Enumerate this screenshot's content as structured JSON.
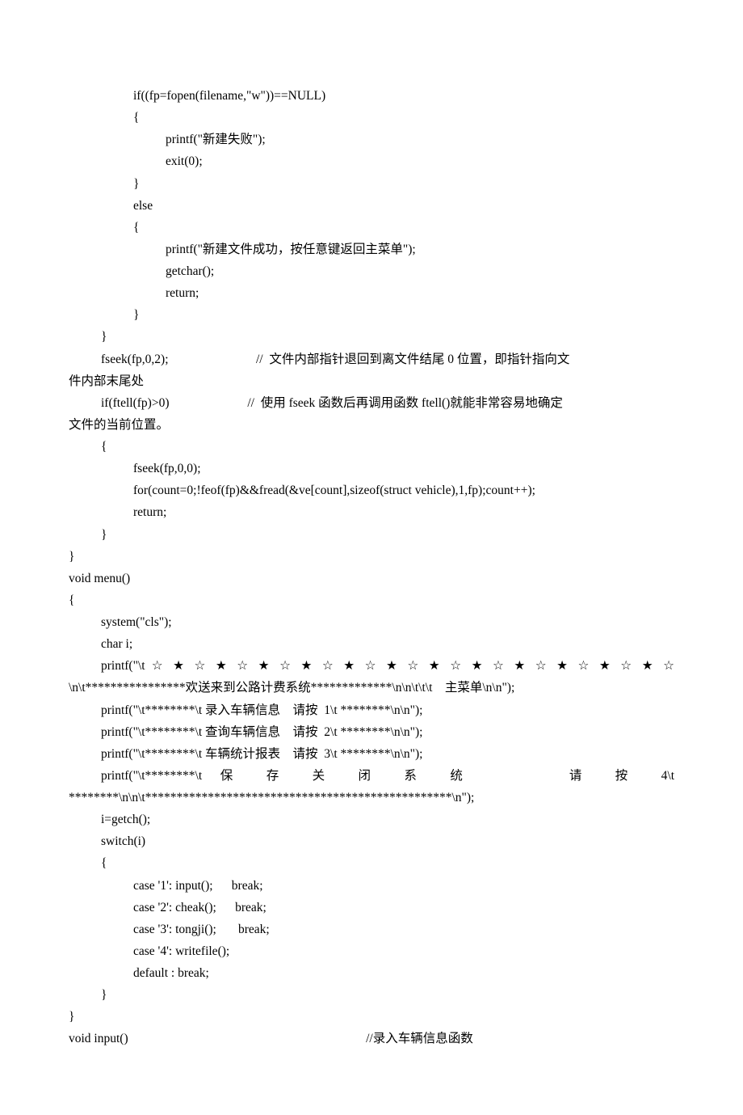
{
  "lines": [
    {
      "cls": "indent2",
      "text": "if((fp=fopen(filename,\"w\"))==NULL)"
    },
    {
      "cls": "indent2",
      "text": "{"
    },
    {
      "cls": "indent3",
      "text": "printf(\"新建失败\");"
    },
    {
      "cls": "indent3",
      "text": "exit(0);"
    },
    {
      "cls": "indent2",
      "text": "}"
    },
    {
      "cls": "indent2",
      "text": "else"
    },
    {
      "cls": "indent2",
      "text": "{"
    },
    {
      "cls": "indent3",
      "text": "printf(\"新建文件成功，按任意键返回主菜单\");"
    },
    {
      "cls": "indent3",
      "text": "getchar();"
    },
    {
      "cls": "indent3",
      "text": "return;"
    },
    {
      "cls": "indent2",
      "text": "}"
    },
    {
      "cls": "indent1",
      "text": "}"
    },
    {
      "cls": "indent1",
      "text": "fseek(fp,0,2);                            //  文件内部指针退回到离文件结尾 0 位置，即指针指向文"
    },
    {
      "cls": "",
      "text": "件内部末尾处"
    },
    {
      "cls": "indent1",
      "text": "if(ftell(fp)>0)                         //  使用 fseek 函数后再调用函数 ftell()就能非常容易地确定"
    },
    {
      "cls": "",
      "text": "文件的当前位置。"
    },
    {
      "cls": "indent1",
      "text": "{"
    },
    {
      "cls": "indent2",
      "text": "fseek(fp,0,0);"
    },
    {
      "cls": "indent2",
      "text": "for(count=0;!feof(fp)&&fread(&ve[count],sizeof(struct vehicle),1,fp);count++);"
    },
    {
      "cls": "indent2",
      "text": "return;"
    },
    {
      "cls": "indent1",
      "text": "}"
    },
    {
      "cls": "",
      "text": "}"
    },
    {
      "cls": "",
      "text": "void menu()"
    },
    {
      "cls": "",
      "text": "{"
    },
    {
      "cls": "indent1",
      "text": "system(\"cls\");"
    },
    {
      "cls": "indent1",
      "text": "char i;"
    },
    {
      "cls": "indent1 wrap-line",
      "text": "printf(\"\\t ☆ ★ ☆ ★ ☆ ★ ☆ ★ ☆ ★ ☆ ★ ☆ ★ ☆ ★ ☆ ★ ☆ ★ ☆ ★ ☆ ★ ☆"
    },
    {
      "cls": "wrap-cont",
      "text": "\\n\\t****************欢送来到公路计费系统*************\\n\\n\\t\\t\\t    主菜单\\n\\n\");"
    },
    {
      "cls": "indent1",
      "text": "printf(\"\\t********\\t 录入车辆信息    请按  1\\t ********\\n\\n\");"
    },
    {
      "cls": "indent1",
      "text": "printf(\"\\t********\\t 查询车辆信息    请按  2\\t ********\\n\\n\");"
    },
    {
      "cls": "indent1",
      "text": "printf(\"\\t********\\t 车辆统计报表    请按  3\\t ********\\n\\n\");"
    },
    {
      "cls": "indent1 wrap-line",
      "text": "printf(\"\\t********\\t 保 存 关 闭 系 统     请 按 4\\t"
    },
    {
      "cls": "wrap-cont",
      "text": "********\\n\\n\\t*************************************************\\n\");"
    },
    {
      "cls": "indent1",
      "text": "i=getch();"
    },
    {
      "cls": "indent1",
      "text": "switch(i)"
    },
    {
      "cls": "indent1",
      "text": "{"
    },
    {
      "cls": "indent2",
      "text": "case '1': input();      break;"
    },
    {
      "cls": "indent2",
      "text": "case '2': cheak();      break;"
    },
    {
      "cls": "indent2",
      "text": "case '3': tongji();       break;"
    },
    {
      "cls": "indent2",
      "text": "case '4': writefile();"
    },
    {
      "cls": "indent2",
      "text": "default : break;"
    },
    {
      "cls": "indent1",
      "text": "}"
    },
    {
      "cls": "",
      "text": "}"
    },
    {
      "cls": "",
      "text": "void input()                                                                            //录入车辆信息函数"
    }
  ]
}
